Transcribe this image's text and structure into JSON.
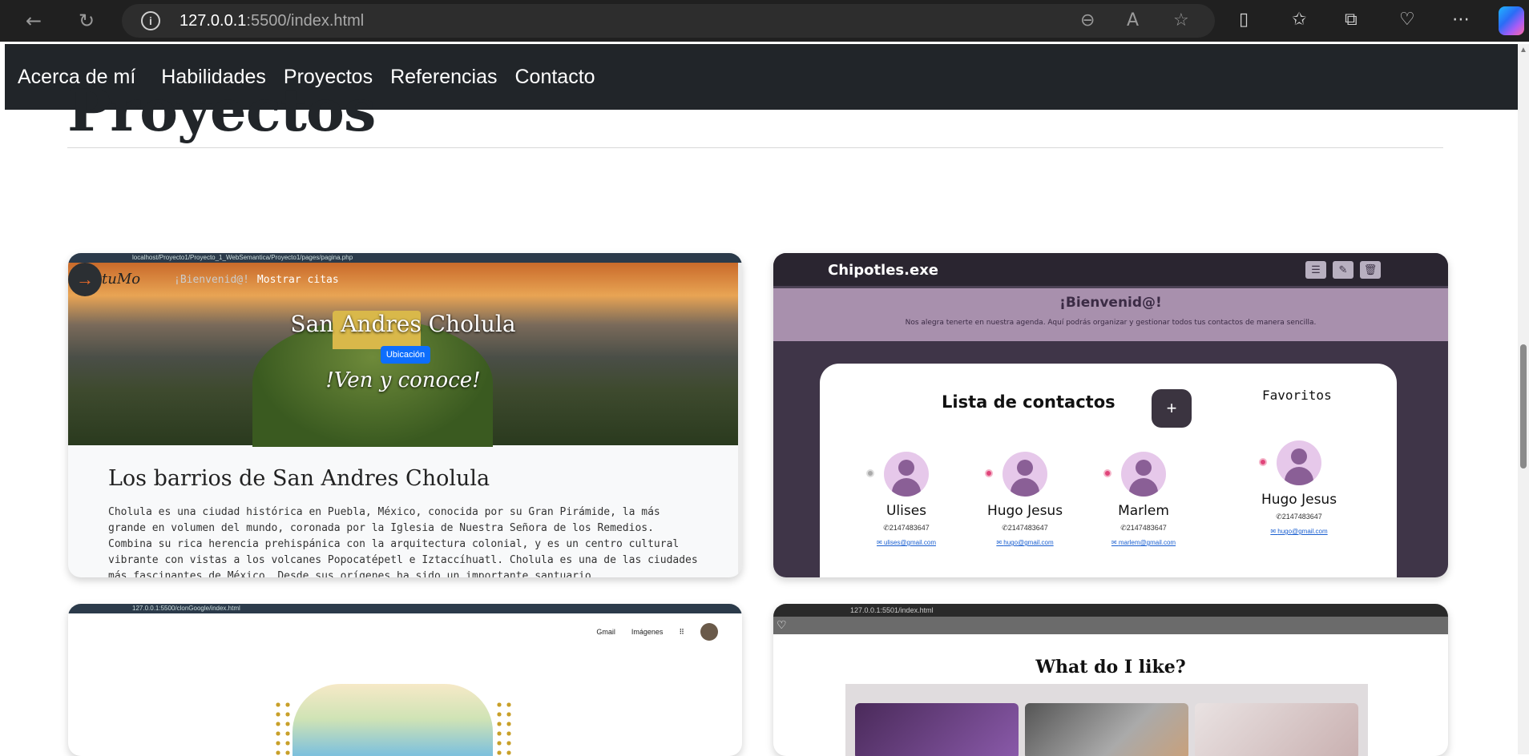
{
  "browser": {
    "url_host": "127.0.0.1",
    "url_rest": ":5500/index.html",
    "icons": [
      "back-icon",
      "refresh-icon",
      "info-icon",
      "zoom-out-icon",
      "read-aloud-icon",
      "favorite-star-icon",
      "split-screen-icon",
      "favorites-icon",
      "collections-icon",
      "browser-essentials-icon",
      "more-icon",
      "copilot-icon"
    ]
  },
  "nav": {
    "items": [
      "Acerca de mí",
      "Habilidades",
      "Proyectos",
      "Referencias",
      "Contacto"
    ]
  },
  "section": {
    "title": "Proyectos"
  },
  "card1": {
    "mini_url": "localhost/Proyecto1/Proyecto_1_WebSemantica/Proyecto1/pages/pagina.php",
    "logo_text": "tuMo",
    "nav_welcome": "¡Bienvenid@!",
    "nav_link": "Mostrar citas",
    "hero_title": "San Andres Cholula",
    "hero_button": "Ubicación",
    "hero_sub": "!Ven y conoce!",
    "heading": "Los barrios de San Andres Cholula",
    "paragraph": "Cholula es una ciudad histórica en Puebla, México, conocida por su Gran Pirámide, la más grande en volumen del mundo, coronada por la Iglesia de Nuestra Señora de los Remedios. Combina su rica herencia prehispánica con la arquitectura colonial, y es un centro cultural vibrante con vistas a los volcanes Popocatépetl e Iztaccíhuatl. Cholula es una de las ciudades más fascinantes de México. Desde sus orígenes ha sido un importante santuario"
  },
  "card2": {
    "brand": "Chipotles.exe",
    "welcome": "¡Bienvenid@!",
    "welcome_sub": "Nos alegra tenerte en nuestra agenda. Aquí podrás organizar y gestionar todos tus contactos de manera sencilla.",
    "list_title": "Lista de contactos",
    "favorites_title": "Favoritos",
    "contacts": [
      {
        "name": "Ulises",
        "phone": "2147483647",
        "email": "ulises@gmail.com",
        "favorite": false
      },
      {
        "name": "Hugo Jesus",
        "phone": "2147483647",
        "email": "hugo@gmail.com",
        "favorite": true
      },
      {
        "name": "Marlem",
        "phone": "2147483647",
        "email": "marlem@gmail.com",
        "favorite": true
      }
    ],
    "favorites": [
      {
        "name": "Hugo Jesus",
        "phone": "2147483647",
        "email": "hugo@gmail.com"
      }
    ]
  },
  "card3": {
    "mini_url": "127.0.0.1:5500/clonGoogle/index.html",
    "link_gmail": "Gmail",
    "link_images": "Imágenes"
  },
  "card4": {
    "mini_url": "127.0.0.1:5501/index.html",
    "heading": "What do I like?"
  }
}
